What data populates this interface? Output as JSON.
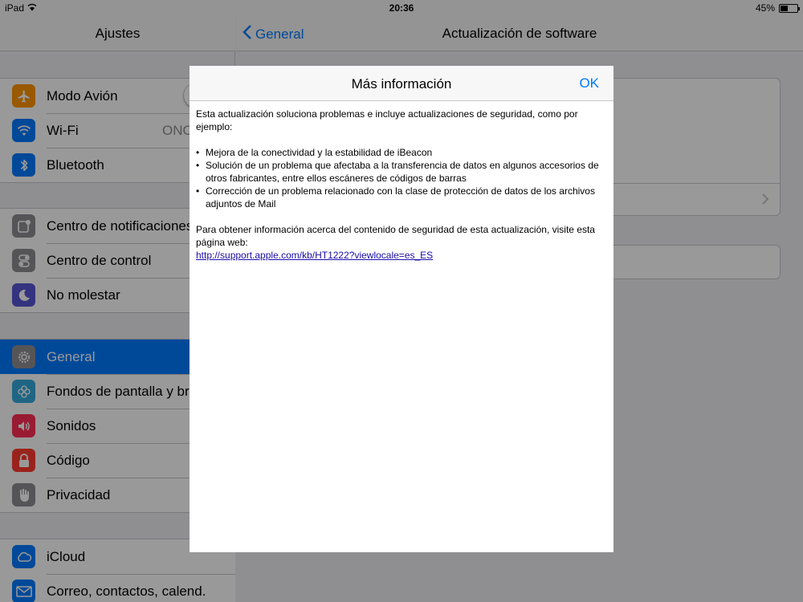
{
  "status_bar": {
    "device": "iPad",
    "time": "20:36",
    "battery": "45%",
    "battery_level": 0.45
  },
  "sidebar": {
    "title": "Ajustes",
    "groups": [
      {
        "items": [
          {
            "label": "Modo Avión",
            "icon": "airplane-icon",
            "color": "#ff9500"
          },
          {
            "label": "Wi-Fi",
            "icon": "wifi-icon",
            "color": "#007aff",
            "value": "ONO"
          },
          {
            "label": "Bluetooth",
            "icon": "bluetooth-icon",
            "color": "#007aff"
          }
        ]
      },
      {
        "items": [
          {
            "label": "Centro de notificaciones",
            "icon": "notifications-icon",
            "color": "#8e8e93"
          },
          {
            "label": "Centro de control",
            "icon": "control-center-icon",
            "color": "#8e8e93"
          },
          {
            "label": "No molestar",
            "icon": "moon-icon",
            "color": "#5856d6"
          }
        ]
      },
      {
        "items": [
          {
            "label": "General",
            "icon": "gear-icon",
            "color": "#8e8e93"
          },
          {
            "label": "Fondos de pantalla y bri",
            "icon": "wallpaper-icon",
            "color": "#34aadc"
          },
          {
            "label": "Sonidos",
            "icon": "speaker-icon",
            "color": "#ff2d55"
          },
          {
            "label": "Código",
            "icon": "lock-icon",
            "color": "#ff3b30"
          },
          {
            "label": "Privacidad",
            "icon": "hand-icon",
            "color": "#8e8e93"
          }
        ]
      },
      {
        "items": [
          {
            "label": "iCloud",
            "icon": "cloud-icon",
            "color": "#007aff"
          },
          {
            "label": "Correo, contactos, calend.",
            "icon": "mail-icon",
            "color": "#007aff"
          }
        ]
      }
    ]
  },
  "detail": {
    "back_label": "General",
    "title": "Actualización de software"
  },
  "modal": {
    "title": "Más información",
    "ok_label": "OK",
    "intro": "Esta actualización soluciona problemas e incluye actualizaciones de seguridad, como por ejemplo:",
    "bullets": [
      "Mejora de la conectividad y la estabilidad de iBeacon",
      "Solución de un problema que afectaba a la transferencia de datos en algunos accesorios de otros fabricantes, entre ellos escáneres de códigos de barras",
      "Corrección de un problema relacionado con la clase de protección de datos de los archivos adjuntos de Mail"
    ],
    "security_text": "Para obtener información acerca del contenido de seguridad de esta actualización, visite esta página web:",
    "link": "http://support.apple.com/kb/HT1222?viewlocale=es_ES"
  }
}
